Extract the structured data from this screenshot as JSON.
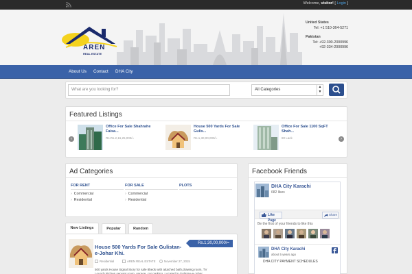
{
  "topbar": {
    "welcome_text": "Welcome, ",
    "visitor": "visitor!",
    "bracket_open": " [ ",
    "login_label": "Login",
    "bracket_close": " ]"
  },
  "header": {
    "logo_name": "AREN",
    "logo_tagline": "REAL ESTATE",
    "contacts": [
      {
        "country": "United States",
        "phones": [
          "Tel: +1 510-364-5271"
        ]
      },
      {
        "country": "Pakistan",
        "phones": [
          "Tel: +92-300-2000996",
          "+92-334-2000996"
        ]
      }
    ]
  },
  "nav": {
    "items": [
      "About Us",
      "Contact",
      "DHA City"
    ]
  },
  "search": {
    "placeholder": "What are you looking for?",
    "category_selected": "All Categories"
  },
  "featured": {
    "title": "Featured Listings",
    "items": [
      {
        "title": "Office For Sale Shahrahe Faisa...",
        "price": "Rs.Rs.2,16,25,000/="
      },
      {
        "title": "House 500 Yards For Sale Gulis...",
        "price": "Rs.1,30,00,000/="
      },
      {
        "title": "Office For Sale 1100 SqFT Shah...",
        "price": "80 Lack"
      }
    ]
  },
  "ad_categories": {
    "title": "Ad Categories",
    "columns": [
      {
        "heading": "FOR RENT",
        "items": [
          "Commercial",
          "Residential"
        ]
      },
      {
        "heading": "FOR SALE",
        "items": [
          "Commercial",
          "Residential"
        ]
      },
      {
        "heading": "PLOTS",
        "items": []
      }
    ]
  },
  "facebook": {
    "title": "Facebook Friends",
    "page_name": "DHA City Karachi",
    "likes": "682 likes",
    "like_button": "Like Page",
    "share_button": "Share",
    "friends_text": "Be the first of your friends to like this",
    "post_name": "DHA City Karachi",
    "post_time": "about 5 years ago",
    "post_text": "DHA CITY PAYMENT SCHEDULES"
  },
  "tabs": [
    "New Listings",
    "Popular",
    "Random"
  ],
  "listing": {
    "title": "House 500 Yards For Sale Gulistan-e-Johar Khi.",
    "price": "Rs.1,30,00,000/=",
    "category": "Residential",
    "author": "AREN REAL ESTATE",
    "date": "November 27, 2015",
    "description": "500 yards House Signal Story for sale 8beds with attached bath,drawing room, TV Lounch,kitchen,servant room, garage, car parking. Located in Gulistan-e-Johar."
  },
  "colors": {
    "nav": "#3a62a8",
    "link": "#2c4f8e",
    "topbar": "#2a2a2a",
    "facebook": "#3b5998"
  }
}
